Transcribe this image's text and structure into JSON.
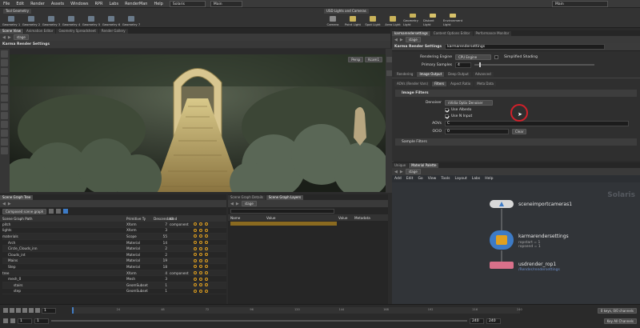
{
  "menubar": {
    "items": [
      "File",
      "Edit",
      "Render",
      "Assets",
      "Windows",
      "RPR",
      "Labs",
      "RenderMan",
      "Help"
    ],
    "desktop": "Solaris",
    "context": "Main",
    "right_context": "Main"
  },
  "shelf": {
    "left_tab": "Tool Geometry",
    "left_tools": [
      "Geometry 1",
      "Geometry 2",
      "Geometry 3",
      "Geometry 4",
      "Geometry 5",
      "Geometry 6",
      "Geometry 7"
    ],
    "right_tab": "USD Lights and Cameras",
    "right_tools": [
      "Camera",
      "Point Light",
      "Spot Light",
      "Area Light",
      "Geometry Light",
      "Distant Light",
      "Environment Light"
    ]
  },
  "viewport": {
    "tabs": [
      "Scene View",
      "Animation Editor",
      "Geometry Spreadsheet",
      "Render Gallery"
    ],
    "path": "stage",
    "title": "Karma Render Settings",
    "persp": "Persp",
    "camera": "Kcam1"
  },
  "params": {
    "tabs": [
      "karmarendersettings",
      "Content Options Editor",
      "Performance Monitor"
    ],
    "path": "stage",
    "node_type": "Karma Render Settings",
    "node_name": "karmarendersettings",
    "rendering_engine_label": "Rendering Engine",
    "rendering_engine_value": "CPU Engine",
    "simplified_shading": "Simplified Shading",
    "primary_samples_label": "Primary Samples",
    "primary_samples_value": "4",
    "main_tabs": [
      "Rendering",
      "Image Output",
      "Deep Output",
      "Advanced"
    ],
    "sub_tabs": [
      "AOVs (Render Vars)",
      "Filters",
      "Aspect Ratio",
      "Meta Data"
    ],
    "image_filters": "Image Filters",
    "denoiser_label": "Denoiser",
    "denoiser_value": "nVidia Optix Denoiser",
    "use_albedo": "Use Albedo",
    "use_n_input": "Use N Input",
    "aov_label": "AOVs",
    "aov_value": "C",
    "ocio_label": "OCIO",
    "ocio_value": "0",
    "clear": "Clear",
    "sample_filters": "Sample Filters"
  },
  "tree": {
    "tabs": [
      "Scene Graph Tree"
    ],
    "dropdown": "Composed scene graph",
    "columns": [
      "Scene Graph Path",
      "Primitive Ty",
      "Descendant",
      "Kind"
    ],
    "rows": [
      {
        "name": "pitch",
        "type": "Xform",
        "count": "7",
        "kind": "component"
      },
      {
        "name": "lights",
        "type": "Xform",
        "count": "3",
        "kind": ""
      },
      {
        "name": "materials",
        "type": "Scope",
        "count": "55",
        "kind": ""
      },
      {
        "name": "Arch",
        "type": "Material",
        "count": "14",
        "kind": ""
      },
      {
        "name": "Circle_Clouds_inn",
        "type": "Material",
        "count": "2",
        "kind": ""
      },
      {
        "name": "Clouds_int",
        "type": "Material",
        "count": "2",
        "kind": ""
      },
      {
        "name": "Mains",
        "type": "Material",
        "count": "19",
        "kind": ""
      },
      {
        "name": "Step",
        "type": "Material",
        "count": "18",
        "kind": ""
      },
      {
        "name": "tree",
        "type": "Xform",
        "count": "4",
        "kind": "component"
      },
      {
        "name": "mesh_0",
        "type": "Mesh",
        "count": "3",
        "kind": ""
      },
      {
        "name": "stairs",
        "type": "GeomSubset",
        "count": "1",
        "kind": ""
      },
      {
        "name": "step",
        "type": "GeomSubset",
        "count": "1",
        "kind": ""
      }
    ]
  },
  "details": {
    "tabs": [
      "Scene Graph Details",
      "Scene Graph Layers"
    ],
    "path": "stage",
    "columns": [
      "Name",
      "Value"
    ],
    "side_tabs": [
      "Value",
      "Metadata"
    ]
  },
  "network": {
    "tabs": [
      "Unique",
      "Material Palette"
    ],
    "path": "stage",
    "menu": [
      "Add",
      "Edit",
      "Go",
      "View",
      "Tools",
      "Layout",
      "Labs",
      "Help"
    ],
    "context_label": "Solaris",
    "nodes": [
      {
        "name": "sceneimportcameras1",
        "sub": ""
      },
      {
        "name": "karmarendersettings",
        "sub": "ropstart = 1\nropsend = 1"
      },
      {
        "name": "usdrender_rop1",
        "sub": "/Render/rendersettings"
      }
    ]
  },
  "timeline": {
    "frame": "1",
    "start": "1",
    "start2": "1",
    "end": "240",
    "end2": "240",
    "ticks": [
      "1",
      "24",
      "48",
      "72",
      "96",
      "120",
      "144",
      "168",
      "192",
      "216",
      "240"
    ],
    "keys": "0 keys, 0/0 channels",
    "key_all": "Key All Channels"
  },
  "colors": {
    "accent": "#e0a020",
    "node_blue": "#3d7bc6",
    "rop_pink": "#d9708a"
  }
}
